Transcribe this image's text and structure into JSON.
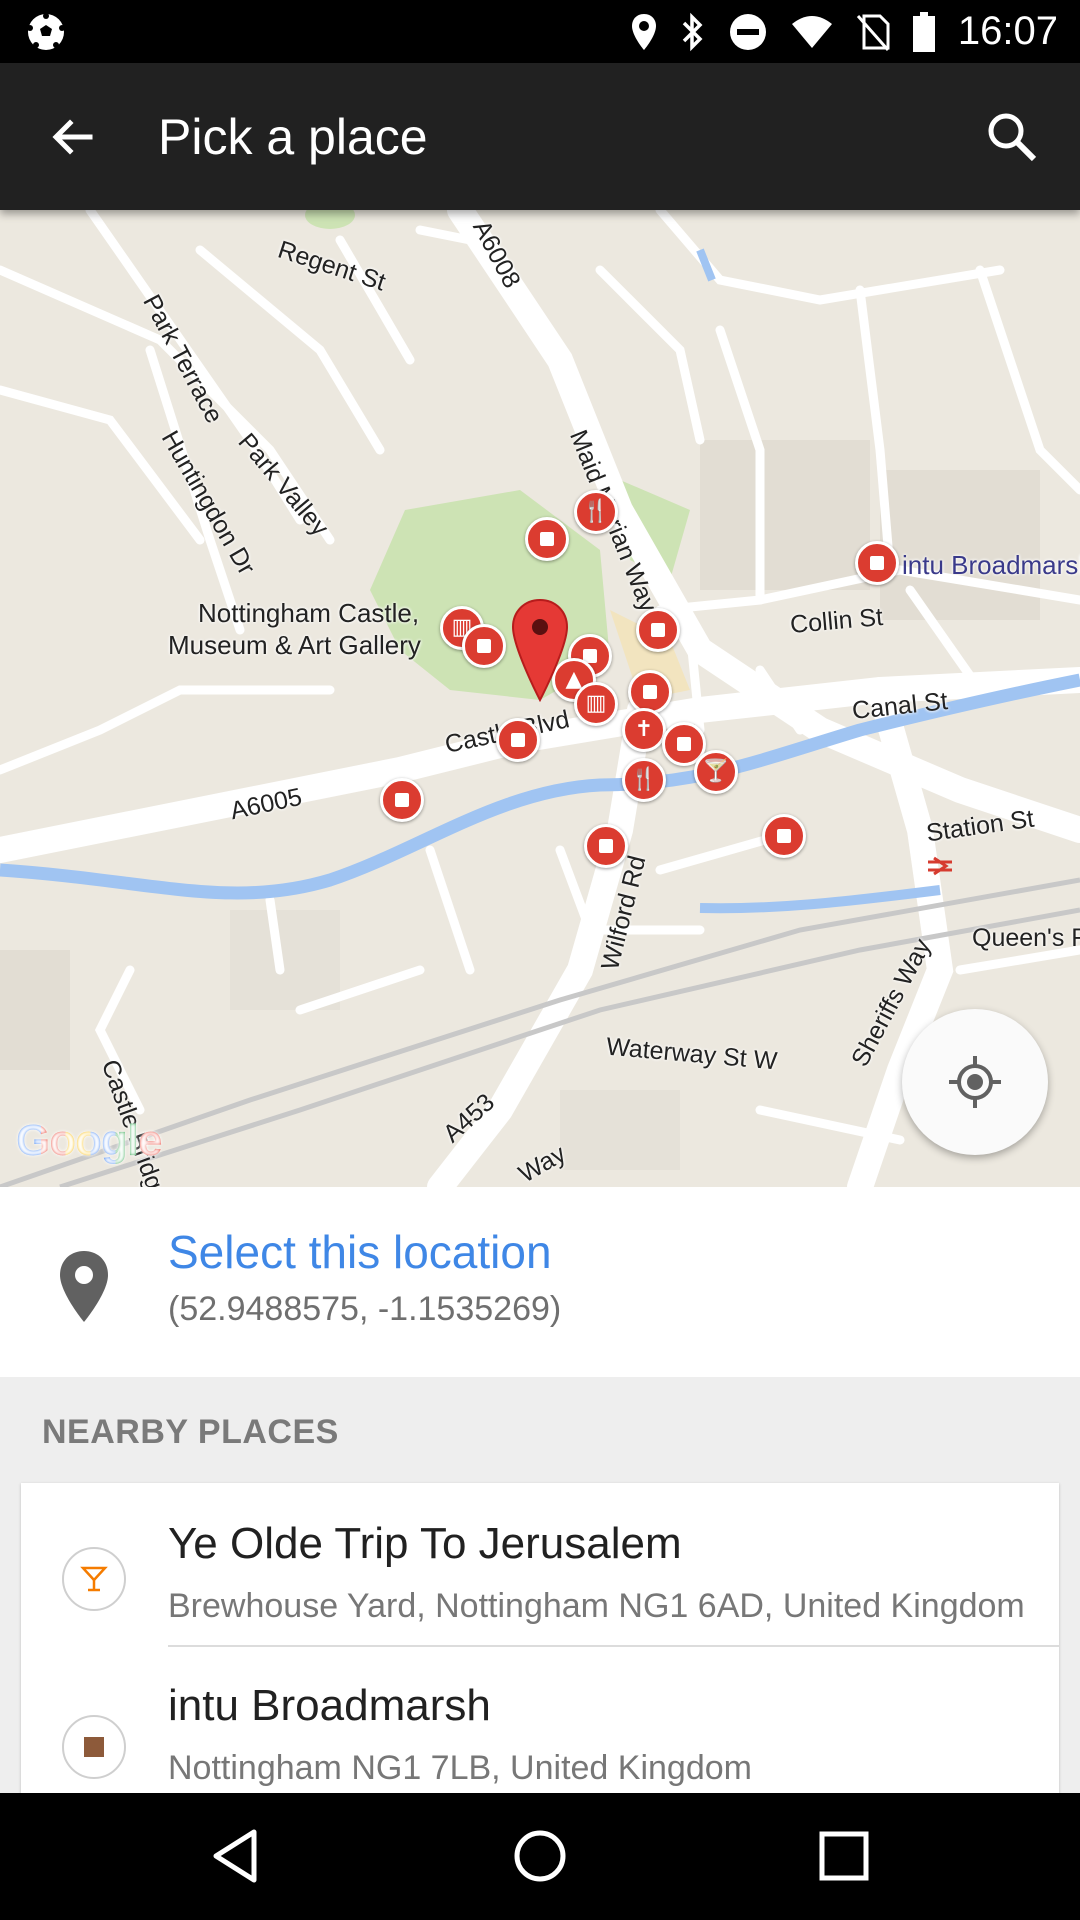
{
  "status_bar": {
    "time": "16:07",
    "icons": [
      "soccer-ball-icon",
      "location-icon",
      "bluetooth-icon",
      "do-not-disturb-icon",
      "wifi-icon",
      "no-sim-icon",
      "battery-icon"
    ]
  },
  "app_bar": {
    "title": "Pick a place",
    "back_icon": "arrow-back-icon",
    "search_icon": "search-icon"
  },
  "map": {
    "labels": {
      "regent_st": "Regent St",
      "a6008": "A6008",
      "park_terrace": "Park Terrace",
      "park_valley": "Park Valley",
      "huntingdon_dr": "Huntingdon Dr",
      "maid_marian_way": "Maid Marian Way",
      "castle_line1": "Nottingham Castle,",
      "castle_line2": "Museum & Art Gallery",
      "intu": "intu Broadmarsh",
      "collin_st": "Collin St",
      "canal_st": "Canal St",
      "castle_blvd": "Castle Blvd",
      "a6005": "A6005",
      "station_st": "Station St",
      "wilford_rd": "Wilford Rd",
      "queens_rd": "Queen's Rd",
      "sheriffs_way": "Sheriffs Way",
      "waterway_st_w": "Waterway St W",
      "a453": "A453",
      "castle_bridge": "Castle Bridge",
      "way": "Way"
    },
    "logo": "Google",
    "my_location_icon": "my-location-icon",
    "accent": "#db3c30"
  },
  "selection": {
    "label": "Select this location",
    "coords": "(52.9488575, -1.1535269)",
    "accent": "#3f87e6"
  },
  "nearby": {
    "header": "NEARBY PLACES",
    "places": [
      {
        "name": "Ye Olde Trip To Jerusalem",
        "address": "Brewhouse Yard, Nottingham NG1 6AD, United Kingdom",
        "icon": "bar-icon"
      },
      {
        "name": "intu Broadmarsh",
        "address": "Nottingham NG1 7LB, United Kingdom",
        "icon": "shopping-icon"
      }
    ]
  },
  "nav_bar": {
    "icons": [
      "back-nav-icon",
      "home-nav-icon",
      "recents-nav-icon"
    ]
  }
}
